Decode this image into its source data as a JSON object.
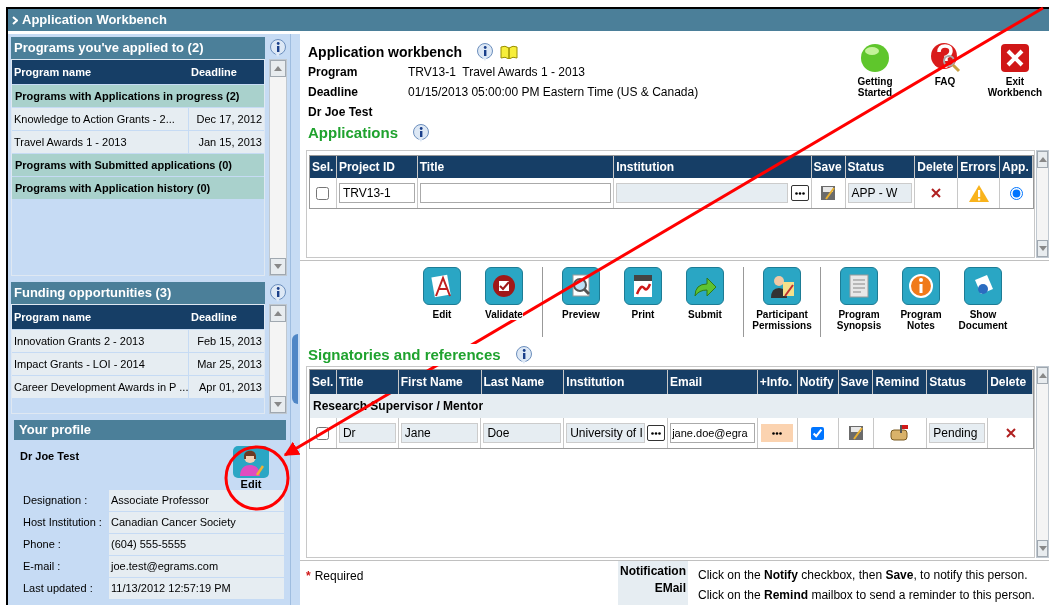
{
  "window": {
    "title": "Application Workbench"
  },
  "applied_panel": {
    "title": "Programs you've applied to (2)",
    "columns": [
      "Program name",
      "Deadline"
    ],
    "groups": [
      {
        "label": "Programs with Applications in progress (2)",
        "rows": [
          {
            "name": "Knowledge to Action Grants - 2...",
            "deadline": "Dec 17, 2012"
          },
          {
            "name": "Travel Awards 1 - 2013",
            "deadline": "Jan 15, 2013"
          }
        ]
      },
      {
        "label": "Programs with Submitted applications (0)"
      },
      {
        "label": "Programs with Application history (0)"
      }
    ]
  },
  "funding_panel": {
    "title": "Funding opportunities (3)",
    "columns": [
      "Program name",
      "Deadline"
    ],
    "rows": [
      {
        "name": "Innovation Grants 2 - 2013",
        "deadline": "Feb 15, 2013"
      },
      {
        "name": "Impact Grants - LOI - 2014",
        "deadline": "Mar 25, 2013"
      },
      {
        "name": "Career Development Awards in P ...",
        "deadline": "Apr 01, 2013"
      }
    ]
  },
  "profile": {
    "title": "Your profile",
    "name": "Dr Joe Test",
    "edit_label": "Edit",
    "fields": [
      {
        "label": "Designation :",
        "value": "Associate Professor"
      },
      {
        "label": "Host Institution :",
        "value": "Canadian Cancer Society"
      },
      {
        "label": "Phone :",
        "value": "(604) 555-5555"
      },
      {
        "label": "E-mail :",
        "value": "joe.test@egrams.com"
      },
      {
        "label": "Last updated :",
        "value": "11/13/2012 12:57:19 PM"
      }
    ]
  },
  "workbench": {
    "title": "Application workbench",
    "program_label": "Program",
    "program_value": "TRV13-1  Travel Awards 1 - 2013",
    "deadline_label": "Deadline",
    "deadline_value": "01/15/2013 05:00:00 PM Eastern Time (US & Canada)",
    "user_name": "Dr Joe Test"
  },
  "top_actions": [
    {
      "kind": "start",
      "label": "Getting Started"
    },
    {
      "kind": "faq",
      "label": "FAQ"
    },
    {
      "kind": "exit",
      "label": "Exit Workbench"
    }
  ],
  "applications": {
    "title": "Applications",
    "columns": [
      "Sel.",
      "Project ID",
      "Title",
      "Institution",
      "Save",
      "Status",
      "Delete",
      "Errors",
      "App."
    ],
    "rows": [
      {
        "checked": false,
        "project_id": "TRV13-1",
        "status": "APP - W",
        "selected": true
      }
    ]
  },
  "toolbar": [
    [
      {
        "kind": "edit",
        "label": "Edit"
      },
      {
        "kind": "validate",
        "label": "Validate"
      }
    ],
    [
      {
        "kind": "preview",
        "label": "Preview"
      },
      {
        "kind": "print",
        "label": "Print"
      },
      {
        "kind": "submit",
        "label": "Submit"
      }
    ],
    [
      {
        "kind": "permissions",
        "label": "Participant Permissions"
      }
    ],
    [
      {
        "kind": "synopsis",
        "label": "Program Synopsis"
      },
      {
        "kind": "notes",
        "label": "Program Notes"
      },
      {
        "kind": "document",
        "label": "Show Document"
      }
    ]
  ],
  "signatories": {
    "title": "Signatories and references",
    "columns": [
      "Sel.",
      "Title",
      "First Name",
      "Last Name",
      "Institution",
      "Email",
      "+Info.",
      "Notify",
      "Save",
      "Remind",
      "Status",
      "Delete"
    ],
    "groups": [
      {
        "label": "Research Supervisor / Mentor",
        "rows": [
          {
            "checked": false,
            "title": "Dr",
            "first_name": "Jane",
            "last_name": "Doe",
            "institution": "University of I",
            "email": "jane.doe@egra",
            "notify": true,
            "status": "Pending"
          }
        ]
      }
    ]
  },
  "footer": {
    "required_mark": "*",
    "required": "Required",
    "notification_label": "Notification EMail",
    "notes": [
      "Click on the **Notify** checkbox, then **Save**, to notify this person.",
      "Click on the **Remind** mailbox to send a reminder to this person."
    ]
  }
}
